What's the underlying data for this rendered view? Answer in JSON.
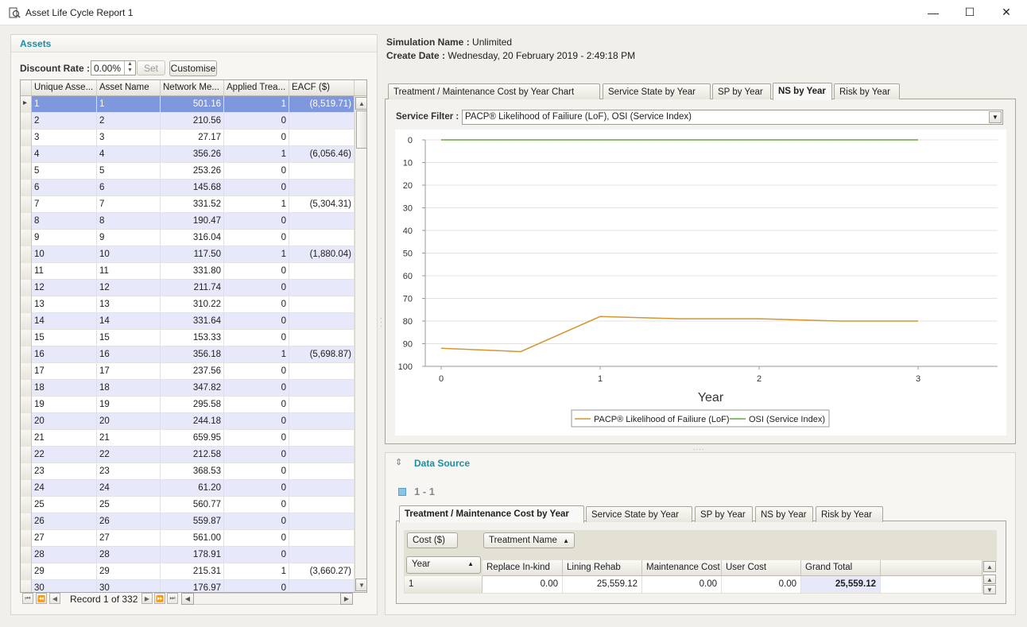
{
  "window": {
    "title": "Asset Life Cycle Report 1",
    "minimize_glyph": "—",
    "maximize_glyph": "☐",
    "close_glyph": "✕"
  },
  "assets_panel": {
    "title": "Assets",
    "discount_rate_label": "Discount Rate :",
    "discount_rate_value": "0.00%",
    "set_label": "Set",
    "customise_label": "Customise",
    "columns": [
      "Unique Asse...",
      "Asset Name",
      "Network Me...",
      "Applied Trea...",
      "EACF ($)"
    ],
    "rows": [
      [
        "1",
        "1",
        "501.16",
        "1",
        "(8,519.71)"
      ],
      [
        "2",
        "2",
        "210.56",
        "0",
        ""
      ],
      [
        "3",
        "3",
        "27.17",
        "0",
        ""
      ],
      [
        "4",
        "4",
        "356.26",
        "1",
        "(6,056.46)"
      ],
      [
        "5",
        "5",
        "253.26",
        "0",
        ""
      ],
      [
        "6",
        "6",
        "145.68",
        "0",
        ""
      ],
      [
        "7",
        "7",
        "331.52",
        "1",
        "(5,304.31)"
      ],
      [
        "8",
        "8",
        "190.47",
        "0",
        ""
      ],
      [
        "9",
        "9",
        "316.04",
        "0",
        ""
      ],
      [
        "10",
        "10",
        "117.50",
        "1",
        "(1,880.04)"
      ],
      [
        "11",
        "11",
        "331.80",
        "0",
        ""
      ],
      [
        "12",
        "12",
        "211.74",
        "0",
        ""
      ],
      [
        "13",
        "13",
        "310.22",
        "0",
        ""
      ],
      [
        "14",
        "14",
        "331.64",
        "0",
        ""
      ],
      [
        "15",
        "15",
        "153.33",
        "0",
        ""
      ],
      [
        "16",
        "16",
        "356.18",
        "1",
        "(5,698.87)"
      ],
      [
        "17",
        "17",
        "237.56",
        "0",
        ""
      ],
      [
        "18",
        "18",
        "347.82",
        "0",
        ""
      ],
      [
        "19",
        "19",
        "295.58",
        "0",
        ""
      ],
      [
        "20",
        "20",
        "244.18",
        "0",
        ""
      ],
      [
        "21",
        "21",
        "659.95",
        "0",
        ""
      ],
      [
        "22",
        "22",
        "212.58",
        "0",
        ""
      ],
      [
        "23",
        "23",
        "368.53",
        "0",
        ""
      ],
      [
        "24",
        "24",
        "61.20",
        "0",
        ""
      ],
      [
        "25",
        "25",
        "560.77",
        "0",
        ""
      ],
      [
        "26",
        "26",
        "559.87",
        "0",
        ""
      ],
      [
        "27",
        "27",
        "561.00",
        "0",
        ""
      ],
      [
        "28",
        "28",
        "178.91",
        "0",
        ""
      ],
      [
        "29",
        "29",
        "215.31",
        "1",
        "(3,660.27)"
      ],
      [
        "30",
        "30",
        "176.97",
        "0",
        ""
      ]
    ],
    "record_text": "Record 1 of 332"
  },
  "simulation": {
    "name_label": "Simulation Name :",
    "name_value": "Unlimited",
    "date_label": "Create Date :",
    "date_value": "Wednesday, 20 February 2019 - 2:49:18 PM"
  },
  "tabs": [
    "Treatment / Maintenance Cost by Year Chart",
    "Service State by Year",
    "SP by Year",
    "NS by Year",
    "Risk by Year"
  ],
  "active_tab": "NS by Year",
  "service_filter": {
    "label": "Service Filter :",
    "value": "PACP® Likelihood of Failiure (LoF), OSI (Service Index)"
  },
  "chart_data": {
    "type": "line",
    "xlabel": "Year",
    "ylabel": "",
    "x_ticks": [
      "0",
      "1",
      "2",
      "3"
    ],
    "y_ticks": [
      "0",
      "10",
      "20",
      "30",
      "40",
      "50",
      "60",
      "70",
      "80",
      "90",
      "100"
    ],
    "ylim": [
      0,
      100
    ],
    "y_reversed": true,
    "xlim": [
      -0.1,
      3.5
    ],
    "series": [
      {
        "name": "PACP® Likelihood of Failiure (LoF)",
        "color": "#d4962e",
        "x": [
          0,
          0.5,
          1,
          1.5,
          2,
          2.5,
          3
        ],
        "y": [
          92,
          93.5,
          78,
          79,
          79,
          80,
          80
        ]
      },
      {
        "name": "OSI (Service Index)",
        "color": "#6aa043",
        "x": [
          0,
          1,
          2,
          3
        ],
        "y": [
          0,
          0,
          0,
          0
        ]
      }
    ],
    "legend_position": "bottom"
  },
  "data_source": {
    "title": "Data Source",
    "node_label": "1 - 1",
    "tabs": [
      "Treatment / Maintenance Cost by Year",
      "Service State by Year",
      "SP by Year",
      "NS by Year",
      "Risk by Year"
    ],
    "data_field": "Cost ($)",
    "column_field": "Treatment Name",
    "row_field": "Year",
    "columns": [
      "Replace In-kind",
      "Lining Rehab",
      "Maintenance Cost",
      "User Cost",
      "Grand Total"
    ],
    "row": {
      "year": "1",
      "values": [
        "0.00",
        "25,559.12",
        "0.00",
        "0.00",
        "25,559.12"
      ]
    }
  }
}
